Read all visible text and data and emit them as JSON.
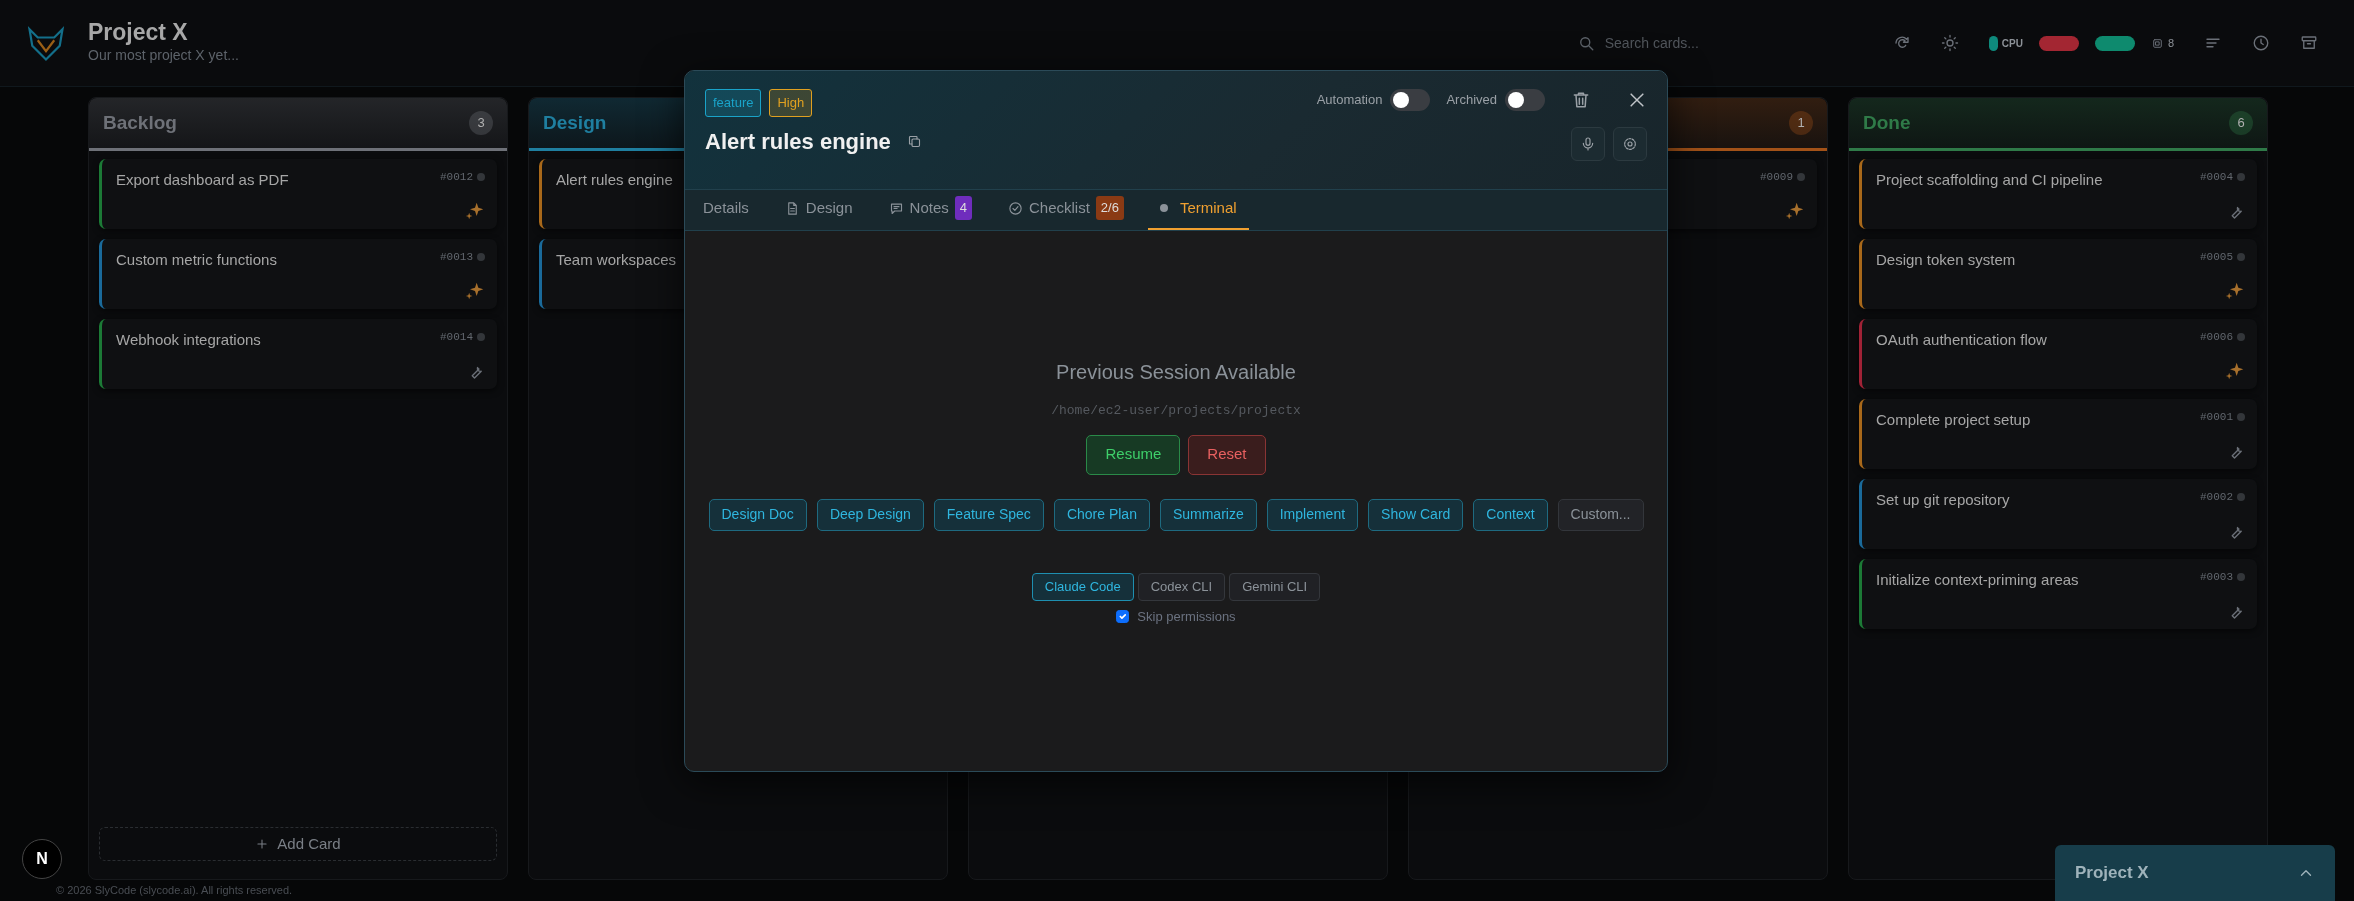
{
  "header": {
    "title": "Project X",
    "subtitle": "Our most project X yet...",
    "search": {
      "placeholder": "Search cards..."
    },
    "stats": [
      {
        "kind": "pill",
        "label": "CPU",
        "color": "#0e8a7c"
      },
      {
        "kind": "pill",
        "color": "#a32632"
      },
      {
        "kind": "pill",
        "color": "#0e8a6e"
      },
      {
        "kind": "count",
        "label": "8"
      }
    ]
  },
  "columns": [
    {
      "title": "Backlog",
      "count": "3",
      "color": "#6e7178",
      "add_label": "Add Card",
      "cards": [
        {
          "title": "Export dashboard as PDF",
          "id": "#0012",
          "color": "#1c7a36",
          "kind": "sparkle"
        },
        {
          "title": "Custom metric functions",
          "id": "#0013",
          "color": "#1a6a9a",
          "kind": "sparkle"
        },
        {
          "title": "Webhook integrations",
          "id": "#0014",
          "color": "#1c7a36",
          "kind": "wrench"
        }
      ]
    },
    {
      "title": "Design",
      "color": "#1f7fa0",
      "cards": [
        {
          "title": "Alert rules engine",
          "color": "#a8681a"
        },
        {
          "title": "Team workspaces",
          "color": "#1a6a9a"
        }
      ]
    },
    {},
    {
      "count": "1",
      "color": "#a35218",
      "cards": [
        {
          "id": "#0009",
          "kind": "sparkle"
        }
      ]
    },
    {
      "title": "Done",
      "count": "6",
      "color": "#2f7a48",
      "cards": [
        {
          "title": "Project scaffolding and CI pipeline",
          "id": "#0004",
          "color": "#a8681a",
          "kind": "wrench"
        },
        {
          "title": "Design token system",
          "id": "#0005",
          "color": "#a8681a",
          "kind": "sparkle"
        },
        {
          "title": "OAuth authentication flow",
          "id": "#0006",
          "color": "#a02236",
          "kind": "sparkle"
        },
        {
          "title": "Complete project setup",
          "id": "#0001",
          "color": "#a8681a",
          "kind": "wrench"
        },
        {
          "title": "Set up git repository",
          "id": "#0002",
          "color": "#1a6a9a",
          "kind": "wrench"
        },
        {
          "title": "Initialize context-priming areas",
          "id": "#0003",
          "color": "#1c7a36",
          "kind": "wrench"
        }
      ]
    }
  ],
  "footer": "© 2026 SlyCode (slycode.ai). All rights reserved.",
  "modal": {
    "tags": [
      {
        "label": "feature",
        "color": "#1aa3c9"
      },
      {
        "label": "High",
        "color": "#e0a020"
      }
    ],
    "title": "Alert rules engine",
    "toggles": [
      {
        "label": "Automation",
        "on": false
      },
      {
        "label": "Archived",
        "on": false
      }
    ],
    "tabs": [
      {
        "label": "Details",
        "kind": "plain",
        "selected": false
      },
      {
        "label": "Design",
        "kind": "doc",
        "selected": false
      },
      {
        "label": "Notes",
        "kind": "chat",
        "badge": {
          "label": "4",
          "color": "#6f2dbd"
        },
        "selected": false
      },
      {
        "label": "Checklist",
        "kind": "check",
        "badge": {
          "label": "2/6",
          "color": "#8a3a14"
        },
        "selected": false
      },
      {
        "label": "Terminal",
        "kind": "dot",
        "selected": true
      }
    ],
    "terminal": {
      "heading": "Previous Session Available",
      "path": "/home/ec2-user/projects/projectx",
      "resume": "Resume",
      "reset": "Reset",
      "prompts": [
        {
          "label": "Design Doc",
          "kind": "preset"
        },
        {
          "label": "Deep Design",
          "kind": "preset"
        },
        {
          "label": "Feature Spec",
          "kind": "preset"
        },
        {
          "label": "Chore Plan",
          "kind": "preset"
        },
        {
          "label": "Summarize",
          "kind": "preset"
        },
        {
          "label": "Implement",
          "kind": "preset"
        },
        {
          "label": "Show Card",
          "kind": "preset"
        },
        {
          "label": "Context",
          "kind": "preset"
        },
        {
          "label": "Custom...",
          "kind": "custom"
        }
      ],
      "agents": [
        {
          "label": "Claude Code",
          "selected": true
        },
        {
          "label": "Codex CLI",
          "selected": false
        },
        {
          "label": "Gemini CLI",
          "selected": false
        }
      ],
      "skip_permissions": {
        "label": "Skip permissions",
        "checked": true
      }
    }
  },
  "dev_badge": "N",
  "dock": {
    "title": "Project X"
  }
}
